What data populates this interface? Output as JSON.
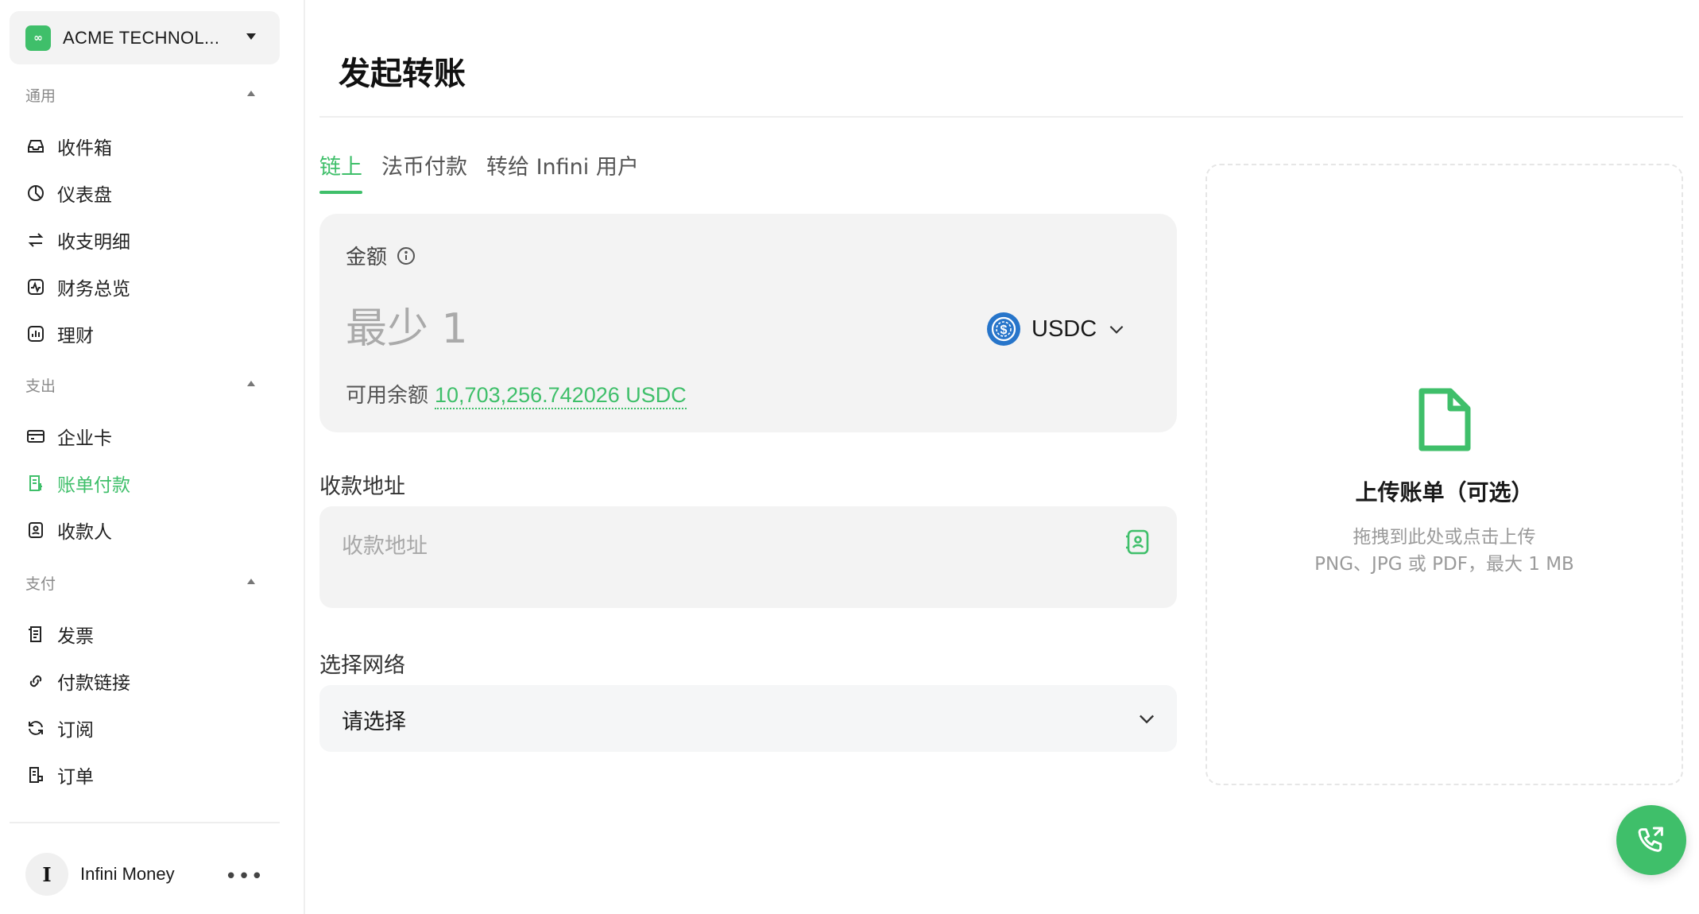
{
  "sidebar": {
    "org_name": "ACME TECHNOL...",
    "org_logo_glyph": "∞",
    "sections": [
      {
        "title": "通用",
        "items": [
          {
            "label": "收件箱",
            "icon": "inbox-icon"
          },
          {
            "label": "仪表盘",
            "icon": "pie-chart-icon"
          },
          {
            "label": "收支明细",
            "icon": "arrows-swap-icon"
          },
          {
            "label": "财务总览",
            "icon": "activity-icon"
          },
          {
            "label": "理财",
            "icon": "bar-chart-icon"
          }
        ]
      },
      {
        "title": "支出",
        "items": [
          {
            "label": "企业卡",
            "icon": "credit-card-icon"
          },
          {
            "label": "账单付款",
            "icon": "bill-icon"
          },
          {
            "label": "收款人",
            "icon": "contact-book-icon"
          }
        ]
      },
      {
        "title": "支付",
        "items": [
          {
            "label": "发票",
            "icon": "invoice-icon"
          },
          {
            "label": "付款链接",
            "icon": "link-icon"
          },
          {
            "label": "订阅",
            "icon": "refresh-icon"
          },
          {
            "label": "订单",
            "icon": "order-icon"
          }
        ]
      }
    ],
    "active_item": "账单付款",
    "user": {
      "initial": "I",
      "name": "Infini Money",
      "more": "•••"
    }
  },
  "main": {
    "title": "发起转账",
    "tabs": [
      {
        "label": "链上",
        "active": true
      },
      {
        "label": "法币付款",
        "active": false
      },
      {
        "label": "转给 Infini 用户",
        "active": false
      }
    ],
    "amount": {
      "label": "金额",
      "placeholder": "最少 1",
      "currency": "USDC",
      "balance_label": "可用余额",
      "balance_value": "10,703,256.742026 USDC"
    },
    "address": {
      "label": "收款地址",
      "placeholder": "收款地址"
    },
    "network": {
      "label": "选择网络",
      "value": "请选择"
    },
    "upload": {
      "title": "上传账单（可选）",
      "hint_line1": "拖拽到此处或点击上传",
      "hint_line2": "PNG、JPG 或 PDF，最大 1 MB"
    }
  },
  "colors": {
    "accent": "#3fbf6a",
    "usdc_blue": "#2775ca"
  }
}
